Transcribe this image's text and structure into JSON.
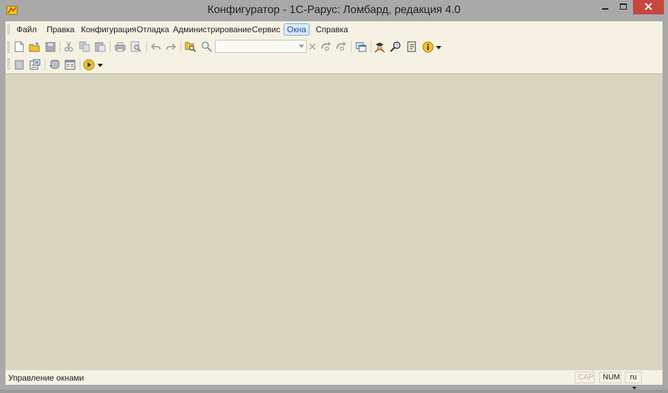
{
  "window": {
    "title": "Конфигуратор - 1С-Рарус: Ломбард, редакция 4.0",
    "controls": {
      "minimize": "minimize-icon",
      "maximize": "maximize-icon",
      "close": "close-icon"
    }
  },
  "menu": {
    "items": [
      "Файл",
      "Правка",
      "Конфигурация",
      "Отладка",
      "Администрирование",
      "Сервис",
      "Окна",
      "Справка"
    ],
    "active": "Окна"
  },
  "toolbar1": {
    "icons": [
      "new-document-icon",
      "open-folder-icon",
      "save-icon",
      "cut-icon",
      "copy-icon",
      "paste-icon",
      "print-icon",
      "print-preview-icon",
      "undo-icon",
      "redo-icon",
      "find-in-document-icon",
      "search-icon",
      "search-dropdown-icon",
      "clear-search-icon",
      "find-next-icon",
      "find-previous-icon",
      "windows-icon",
      "assistant-icon",
      "syntax-helper-icon",
      "help-book-icon",
      "info-icon"
    ],
    "search_value": ""
  },
  "toolbar2": {
    "icons": [
      "table-icon",
      "spreadsheet-icon",
      "database-update-icon",
      "metadata-icon",
      "run-debug-icon"
    ]
  },
  "statusbar": {
    "text": "Управление окнами",
    "cap": "CAP",
    "num": "NUM",
    "lang": "ru"
  },
  "colors": {
    "workspace": "#d8d6c0",
    "chrome": "#f5f2e3",
    "close_button": "#c7463e",
    "active_menu_border": "#84acdd"
  }
}
